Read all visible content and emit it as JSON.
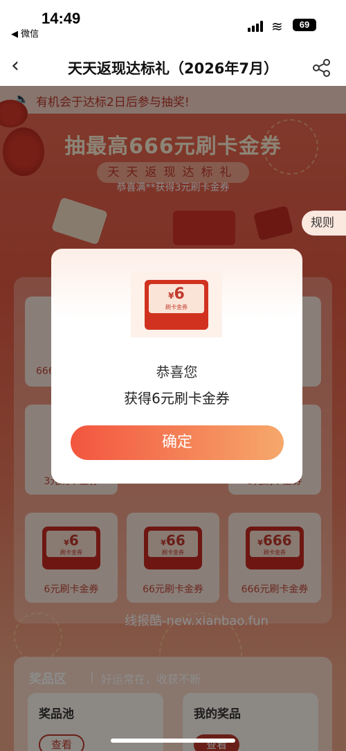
{
  "status_bar": {
    "time": "14:49",
    "back_app": "◀ 微信",
    "battery": "69"
  },
  "nav": {
    "title": "天天返现达标礼（2026年7月）"
  },
  "notice": {
    "text": "有机会于达标2日后参与抽奖!"
  },
  "banner": {
    "title": "抽最高666元刷卡金券",
    "subtitle": "天天返现达标礼",
    "congrats": "恭喜满**获得3元刷卡金券",
    "rules": "规则"
  },
  "grid": {
    "row1_left_label": "666",
    "row2_left_label": "3元刷卡金券",
    "row2_right_label": "3元刷卡金券",
    "bottom_cards": [
      {
        "amount": "6",
        "tag": "刷卡金券",
        "label": "6元刷卡金券"
      },
      {
        "amount": "66",
        "tag": "刷卡金券",
        "label": "66元刷卡金券"
      },
      {
        "amount": "666",
        "tag": "刷卡金券",
        "label": "666元刷卡金券"
      }
    ],
    "currency": "¥"
  },
  "watermark": "线报酷-new.xianbao.fun",
  "prize_section": {
    "title": "奖品区",
    "slogan": "好运常在，收获不断",
    "pool_title": "奖品池",
    "pool_button": "查看",
    "mine_title": "我的奖品",
    "mine_button": "查看"
  },
  "modal": {
    "currency": "¥",
    "amount": "6",
    "tag": "刷卡金券",
    "line1": "恭喜您",
    "line2": "获得6元刷卡金券",
    "confirm": "确定"
  },
  "colors": {
    "brand_red": "#c0392b",
    "button_start": "#f3553f",
    "button_end": "#f6a86b"
  }
}
